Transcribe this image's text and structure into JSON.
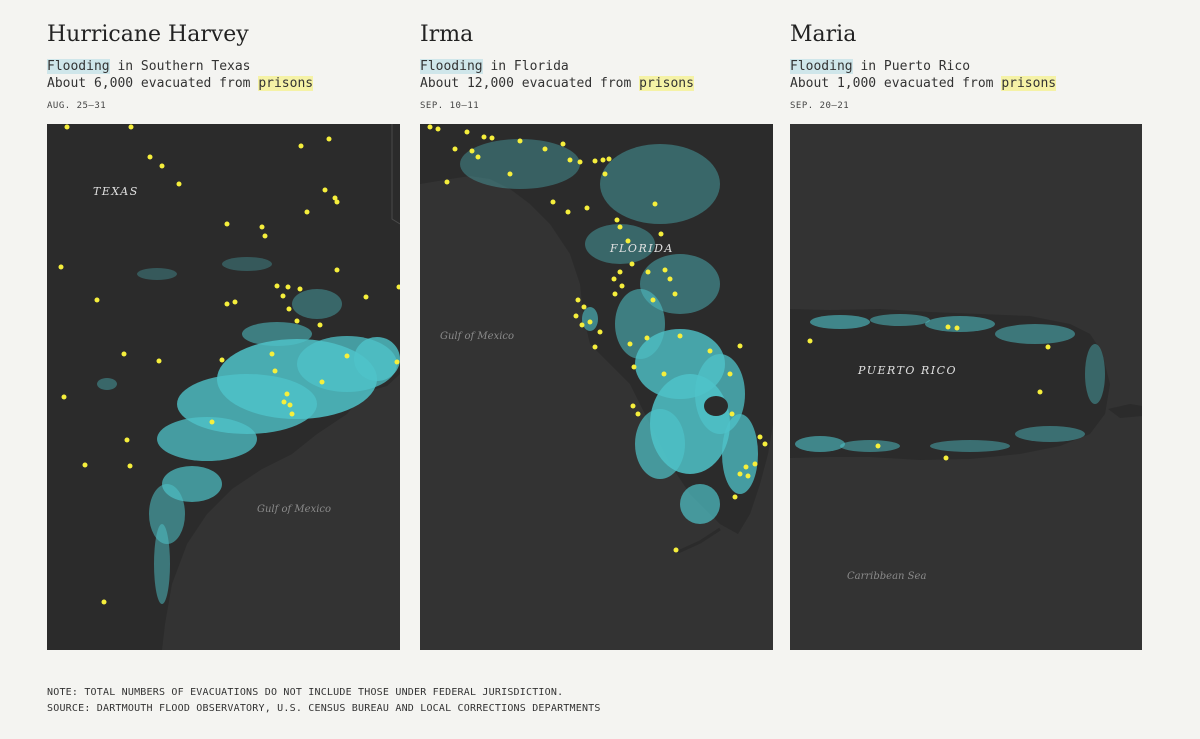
{
  "panels": [
    {
      "title": "Hurricane Harvey",
      "flood_word": "Flooding",
      "flood_rest": " in Southern Texas",
      "evac_text": "About 6,000 evacuated from ",
      "prison_word": "prisons",
      "date": "AUG. 25–31",
      "region_label": "TEXAS",
      "water_label": "Gulf of Mexico"
    },
    {
      "title": "Irma",
      "flood_word": "Flooding",
      "flood_rest": " in Florida",
      "evac_text": "About 12,000 evacuated from ",
      "prison_word": "prisons",
      "date": "SEP. 10–11",
      "region_label": "FLORIDA",
      "water_label": "Gulf of Mexico"
    },
    {
      "title": "Maria",
      "flood_word": "Flooding",
      "flood_rest": " in Puerto Rico",
      "evac_text": "About 1,000 evacuated from ",
      "prison_word": "prisons",
      "date": "SEP. 20–21",
      "region_label": "PUERTO RICO",
      "water_label": "Carribbean Sea"
    }
  ],
  "footer": {
    "note": "NOTE: TOTAL NUMBERS OF EVACUATIONS DO NOT INCLUDE THOSE UNDER FEDERAL JURISDICTION.",
    "source": "SOURCE: DARTMOUTH FLOOD OBSERVATORY, U.S. CENSUS BUREAU AND LOCAL CORRECTIONS DEPARTMENTS"
  },
  "colors": {
    "background": "#f4f4f1",
    "water": "#333333",
    "land": "#2b2b2b",
    "flooding": "#4fc3c9",
    "prison_dot": "#f6ef3c",
    "flood_highlight": "#cfe6ea",
    "prison_highlight": "#f5f2a6"
  }
}
